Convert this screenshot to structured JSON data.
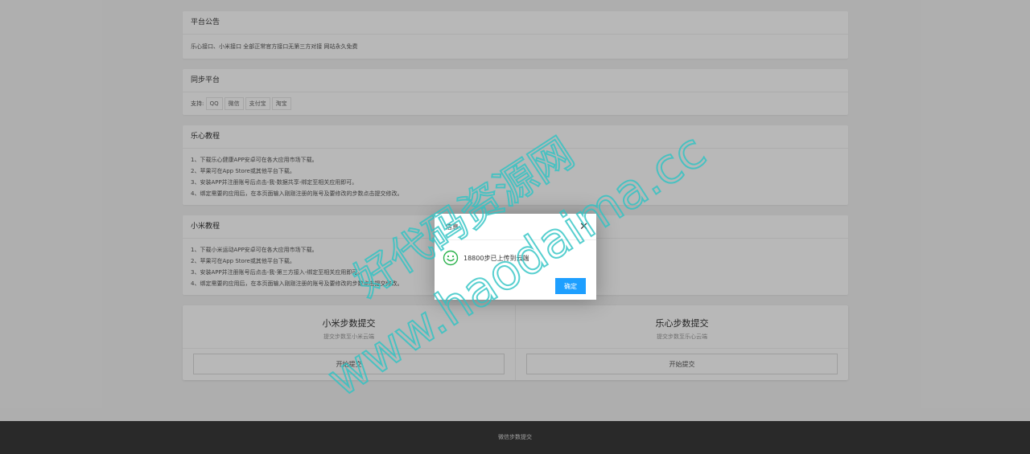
{
  "notice": {
    "title": "平台公告",
    "text": "乐心接口、小米接口 全部正常官方接口无第三方对接 网站永久免费"
  },
  "sync": {
    "title": "同步平台",
    "label": "支持:",
    "platforms": [
      "QQ",
      "微信",
      "支付宝",
      "淘宝"
    ]
  },
  "lexin_tutorial": {
    "title": "乐心教程",
    "steps": [
      "1、下载乐心健康APP安卓可在各大应用市场下载。",
      "2、苹果可在App Store或其他平台下载。",
      "3、安装APP并注册账号后点击-我-数据共享-绑定至相关应用即可。",
      "4、绑定需要的应用后，在本页面输入刚刚注册的账号及要修改的步数点击提交修改。"
    ]
  },
  "xiaomi_tutorial": {
    "title": "小米教程",
    "steps": [
      "1、下载小米运动APP安卓可在各大应用市场下载。",
      "2、苹果可在App Store或其他平台下载。",
      "3、安装APP并注册账号后点击-我-第三方接入-绑定至相关应用即可。",
      "4、绑定需要的应用后，在本页面输入刚刚注册的账号及要修改的步数点击提交修改。"
    ]
  },
  "submit": {
    "xiaomi": {
      "title": "小米步数提交",
      "subtitle": "提交步数至小米云端",
      "button": "开始提交"
    },
    "lexin": {
      "title": "乐心步数提交",
      "subtitle": "提交步数至乐心云端",
      "button": "开始提交"
    }
  },
  "footer": {
    "text": "微信步数提交"
  },
  "dialog": {
    "title": "信息",
    "close": "✕",
    "message": "18800步已上传到云端",
    "ok": "确定",
    "icon": "smile-icon"
  },
  "watermark": {
    "cn": "好代码资源网",
    "url": "www.haodaima.cc"
  },
  "colors": {
    "accent": "#1e9fff",
    "icon_green": "#2bb24c",
    "watermark": "#2ec4c4",
    "footer": "#393939"
  }
}
